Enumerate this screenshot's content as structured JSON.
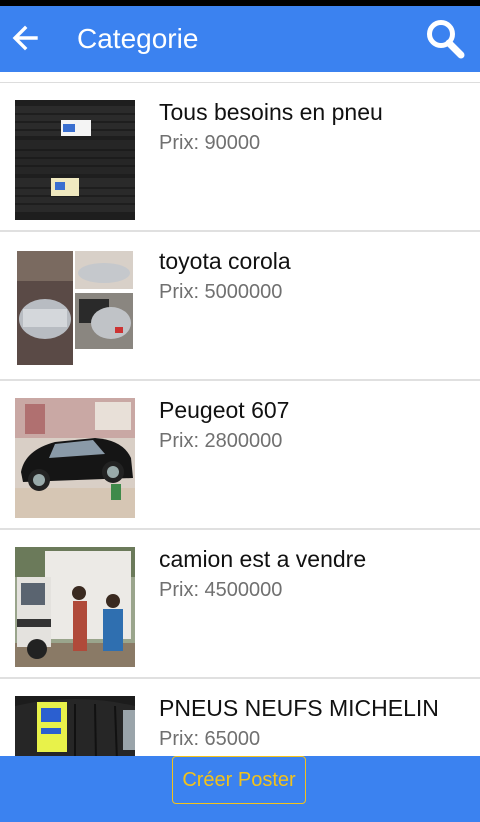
{
  "header": {
    "title": "Categorie",
    "back_icon": "arrow-left-icon",
    "search_icon": "search-icon",
    "color": "#3b82f0"
  },
  "listings": [
    {
      "title": "Tous besoins en pneu",
      "price": "Prix: 90000",
      "image": "stacked-tires-photo"
    },
    {
      "title": "toyota corola",
      "price": "Prix: 5000000",
      "image": "silver-sedan-collage-photo"
    },
    {
      "title": "Peugeot 607",
      "price": "Prix: 2800000",
      "image": "black-sedan-photo"
    },
    {
      "title": "camion est a vendre",
      "price": "Prix: 4500000",
      "image": "white-box-truck-photo"
    },
    {
      "title": "PNEUS NEUFS MICHELIN",
      "price": "Prix: 65000",
      "image": "michelin-tire-photo"
    }
  ],
  "footer": {
    "create_label": "Créer Poster",
    "accent": "#f2c21b"
  }
}
